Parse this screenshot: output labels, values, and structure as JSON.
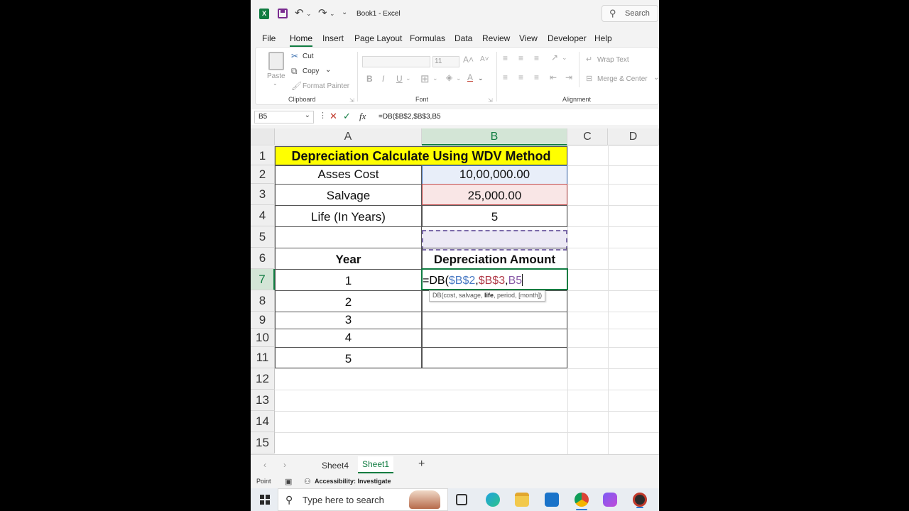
{
  "app": {
    "title": "Book1  -  Excel",
    "search_label": "Search"
  },
  "menu": {
    "tabs": [
      "File",
      "Home",
      "Insert",
      "Page Layout",
      "Formulas",
      "Data",
      "Review",
      "View",
      "Developer",
      "Help"
    ],
    "active": "Home"
  },
  "ribbon": {
    "clipboard": {
      "paste": "Paste",
      "cut": "Cut",
      "copy": "Copy",
      "format_painter": "Format Painter",
      "label": "Clipboard"
    },
    "font": {
      "size": "11",
      "bold": "B",
      "italic": "I",
      "underline": "U",
      "label": "Font"
    },
    "alignment": {
      "wrap_text": "Wrap Text",
      "merge_center": "Merge & Center",
      "label": "Alignment"
    }
  },
  "formula_bar": {
    "name_box": "B5",
    "fx": "fx",
    "formula": "=DB($B$2,$B$3,B5"
  },
  "grid": {
    "columns": [
      "A",
      "B",
      "C",
      "D"
    ],
    "rows": [
      "1",
      "2",
      "3",
      "4",
      "5",
      "6",
      "7",
      "8",
      "9",
      "10",
      "11",
      "12",
      "13",
      "14",
      "15"
    ],
    "title": "Depreciation Calculate Using WDV Method",
    "params": [
      {
        "label": "Asses Cost",
        "value": "10,00,000.00"
      },
      {
        "label": "Salvage",
        "value": "25,000.00"
      },
      {
        "label": "Life (In Years)",
        "value": "5"
      }
    ],
    "header_year": "Year",
    "header_amount": "Depreciation Amount",
    "years": [
      "1",
      "2",
      "3",
      "4",
      "5"
    ],
    "editing": {
      "prefix": "=DB(",
      "ref1": "$B$2",
      "ref2": "$B$3",
      "ref3": "B5",
      "sep": ","
    },
    "tooltip": {
      "pre": "DB(cost, salvage, ",
      "bold": "life",
      "post": ", period, [month])"
    }
  },
  "sheets": {
    "tabs": [
      "Sheet4",
      "Sheet1"
    ],
    "active": "Sheet1",
    "add": "+"
  },
  "status": {
    "mode": "Point",
    "accessibility": "Accessibility: Investigate"
  },
  "taskbar": {
    "search_placeholder": "Type here to search"
  },
  "colors": {
    "accent": "#107c41",
    "title_fill": "#ffff00",
    "ref_blue": "#4a7bc4",
    "ref_red": "#c24a4a",
    "ref_purple": "#7b6aa8"
  }
}
